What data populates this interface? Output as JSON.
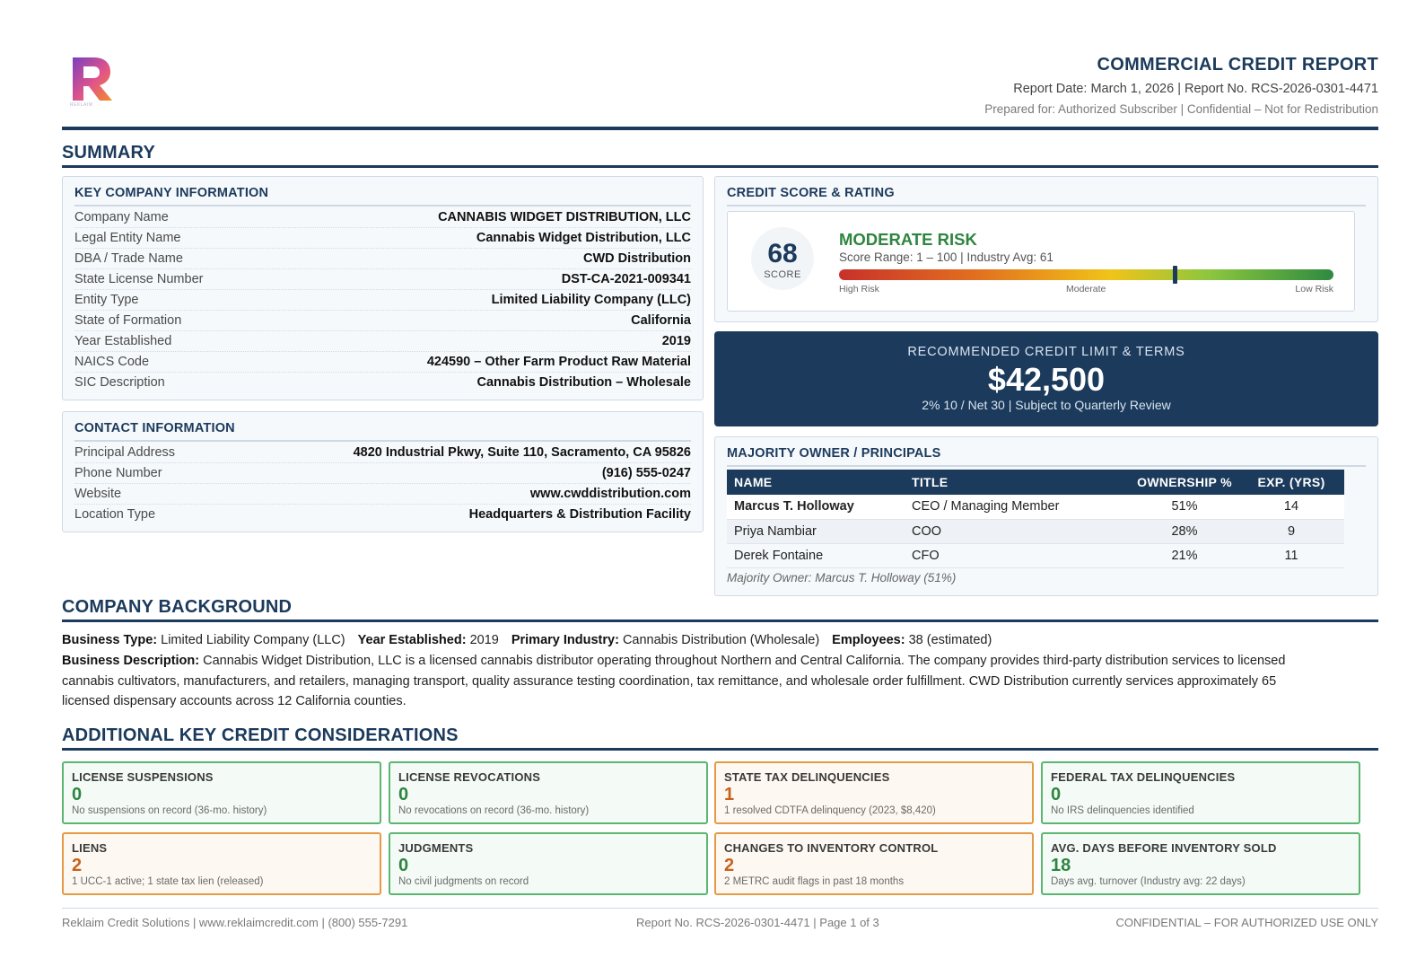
{
  "header": {
    "logo_text": "REKLAIM",
    "title": "COMMERCIAL CREDIT REPORT",
    "meta": "Report Date: March 1, 2026  |  Report No. RCS-2026-0301-4471",
    "prepared": "Prepared for: Authorized Subscriber  |  Confidential – Not for Redistribution",
    "brand_colors": [
      "#7b3fbf",
      "#e0548a",
      "#f28c28"
    ]
  },
  "summary": {
    "title": "SUMMARY",
    "key_info": {
      "title": "KEY COMPANY INFORMATION",
      "rows": [
        {
          "k": "Company Name",
          "v": "CANNABIS WIDGET DISTRIBUTION, LLC"
        },
        {
          "k": "Legal Entity Name",
          "v": "Cannabis Widget Distribution, LLC"
        },
        {
          "k": "DBA / Trade Name",
          "v": "CWD Distribution"
        },
        {
          "k": "State License Number",
          "v": "DST-CA-2021-009341"
        },
        {
          "k": "Entity Type",
          "v": "Limited Liability Company (LLC)"
        },
        {
          "k": "State of Formation",
          "v": "California"
        },
        {
          "k": "Year Established",
          "v": "2019"
        },
        {
          "k": "NAICS Code",
          "v": "424590 – Other Farm Product Raw Material"
        },
        {
          "k": "SIC Description",
          "v": "Cannabis Distribution – Wholesale"
        }
      ]
    },
    "contact": {
      "title": "CONTACT INFORMATION",
      "rows": [
        {
          "k": "Principal Address",
          "v": "4820 Industrial Pkwy, Suite 110, Sacramento, CA 95826"
        },
        {
          "k": "Phone Number",
          "v": "(916) 555-0247"
        },
        {
          "k": "Website",
          "v": "www.cwddistribution.com"
        },
        {
          "k": "Location Type",
          "v": "Headquarters & Distribution Facility"
        }
      ]
    },
    "score": {
      "title": "CREDIT SCORE & RATING",
      "value": "68",
      "score_fraction": 0.68,
      "label": "SCORE",
      "risk": "MODERATE RISK",
      "range": "Score Range: 1 – 100  |  Industry Avg: 61",
      "tick_high": "High Risk",
      "tick_mid": "Moderate",
      "tick_low": "Low Risk"
    },
    "limit": {
      "heading": "RECOMMENDED CREDIT LIMIT & TERMS",
      "amount": "$42,500",
      "terms": "2% 10 / Net 30  |  Subject to Quarterly Review"
    },
    "owners": {
      "title": "MAJORITY OWNER / PRINCIPALS",
      "headers": [
        "NAME",
        "TITLE",
        "OWNERSHIP %",
        "EXP. (YRS)"
      ],
      "rows": [
        {
          "name": "Marcus T. Holloway",
          "title": "CEO / Managing Member",
          "own": "51%",
          "exp": "14"
        },
        {
          "name": "Priya Nambiar",
          "title": "COO",
          "own": "28%",
          "exp": "9"
        },
        {
          "name": "Derek Fontaine",
          "title": "CFO",
          "own": "21%",
          "exp": "11"
        }
      ],
      "note": "Majority Owner: Marcus T. Holloway (51%)"
    }
  },
  "background": {
    "title": "COMPANY BACKGROUND",
    "business_type_label": "Business Type:",
    "business_type": "Limited Liability Company (LLC)",
    "year_label": "Year Established:",
    "year": "2019",
    "industry_label": "Primary Industry:",
    "industry": "Cannabis Distribution (Wholesale)",
    "employees_label": "Employees:",
    "employees": "38 (estimated)",
    "description_label": "Business Description:",
    "description_l1": "Cannabis Widget Distribution, LLC is a licensed cannabis distributor operating throughout Northern and Central California. The company provides third-party distribution services to licensed",
    "description_l2": "cannabis cultivators, manufacturers, and retailers, managing transport, quality assurance testing coordination, tax remittance, and wholesale order fulfillment. CWD Distribution currently services approximately 65",
    "description_l3": "licensed dispensary accounts across 12 California counties."
  },
  "considerations": {
    "title": "ADDITIONAL KEY CREDIT CONSIDERATIONS",
    "items": [
      {
        "title": "LICENSE SUSPENSIONS",
        "value": "0",
        "desc": "No suspensions on record (36-mo. history)",
        "status": "ok"
      },
      {
        "title": "LICENSE REVOCATIONS",
        "value": "0",
        "desc": "No revocations on record (36-mo. history)",
        "status": "ok"
      },
      {
        "title": "STATE TAX DELINQUENCIES",
        "value": "1",
        "desc": "1 resolved CDTFA delinquency (2023, $8,420)",
        "status": "warn"
      },
      {
        "title": "FEDERAL TAX DELINQUENCIES",
        "value": "0",
        "desc": "No IRS delinquencies identified",
        "status": "ok"
      },
      {
        "title": "LIENS",
        "value": "2",
        "desc": "1 UCC-1 active; 1 state tax lien (released)",
        "status": "warn"
      },
      {
        "title": "JUDGMENTS",
        "value": "0",
        "desc": "No civil judgments on record",
        "status": "ok"
      },
      {
        "title": "CHANGES TO INVENTORY CONTROL",
        "value": "2",
        "desc": "2 METRC audit flags in past 18 months",
        "status": "warn"
      },
      {
        "title": "AVG. DAYS BEFORE INVENTORY SOLD",
        "value": "18",
        "desc": "Days avg. turnover (Industry avg: 22 days)",
        "status": "ok"
      }
    ]
  },
  "footer": {
    "left": "Reklaim Credit Solutions  |  www.reklaimcredit.com  |  (800) 555-7291",
    "center": "Report No. RCS-2026-0301-4471  |  Page 1 of 3",
    "right": "CONFIDENTIAL – FOR AUTHORIZED USE ONLY"
  }
}
